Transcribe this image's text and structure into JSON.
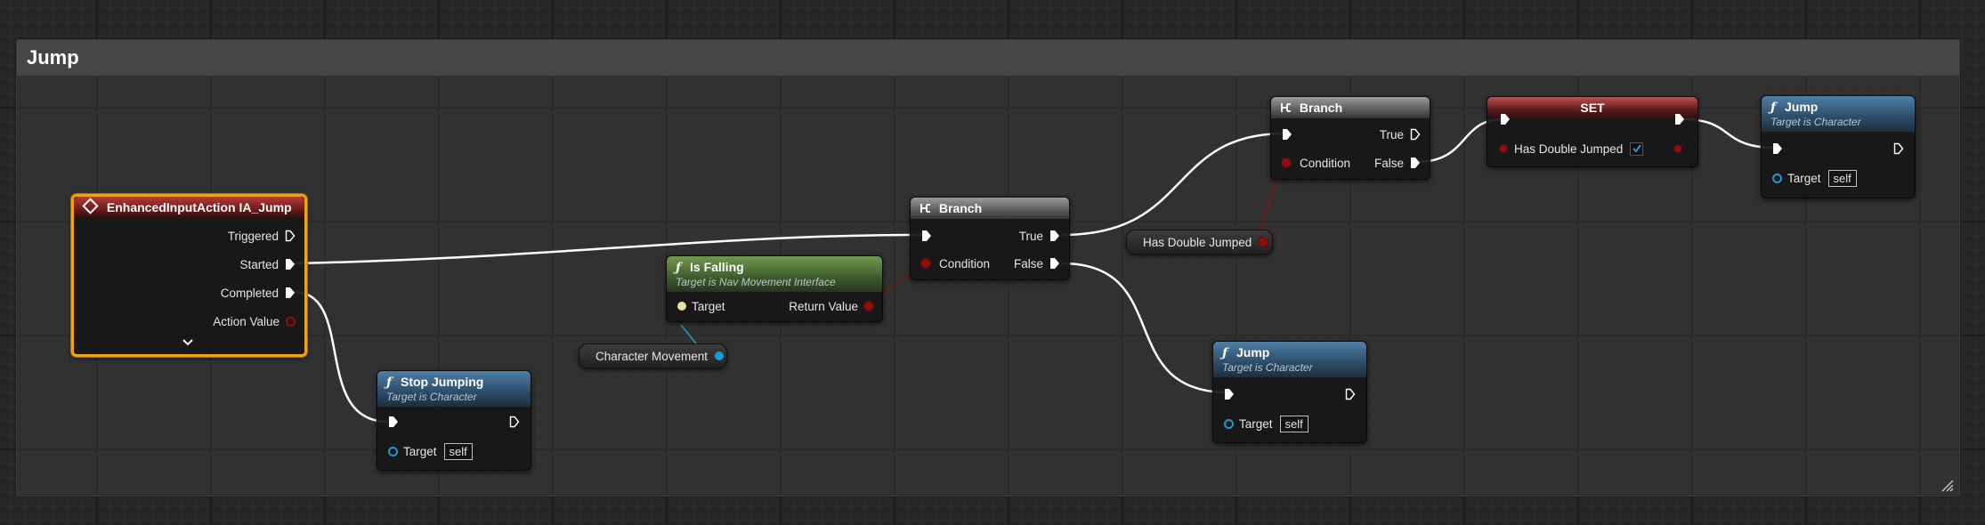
{
  "comment": {
    "title": "Jump"
  },
  "nodes": {
    "input_action": {
      "title": "EnhancedInputAction IA_Jump",
      "pins": {
        "triggered": "Triggered",
        "started": "Started",
        "completed": "Completed",
        "action_value": "Action Value"
      },
      "expand_icon": "chevron-down-icon"
    },
    "stop_jumping": {
      "title": "Stop Jumping",
      "subtitle": "Target is Character",
      "target_label": "Target",
      "target_value": "self"
    },
    "character_movement": {
      "label": "Character Movement"
    },
    "is_falling": {
      "title": "Is Falling",
      "subtitle": "Target is Nav Movement Interface",
      "target_label": "Target",
      "return_label": "Return Value"
    },
    "branch1": {
      "title": "Branch",
      "condition_label": "Condition",
      "true_label": "True",
      "false_label": "False"
    },
    "jump_false": {
      "title": "Jump",
      "subtitle": "Target is Character",
      "target_label": "Target",
      "target_value": "self"
    },
    "has_double_jumped_get": {
      "label": "Has Double Jumped"
    },
    "branch2": {
      "title": "Branch",
      "condition_label": "Condition",
      "true_label": "True",
      "false_label": "False"
    },
    "set": {
      "title": "SET",
      "var_label": "Has Double Jumped",
      "checked": true
    },
    "jump_final": {
      "title": "Jump",
      "subtitle": "Target is Character",
      "target_label": "Target",
      "target_value": "self"
    }
  },
  "colors": {
    "selected_border": "#f0a30a",
    "exec_wire": "#ffffff",
    "bool_wire": "#8c1010",
    "object_wire": "#1a9bd8",
    "function_header": "#2c4c68",
    "pure_header": "#3e5b2c",
    "event_header": "#5d1717"
  }
}
